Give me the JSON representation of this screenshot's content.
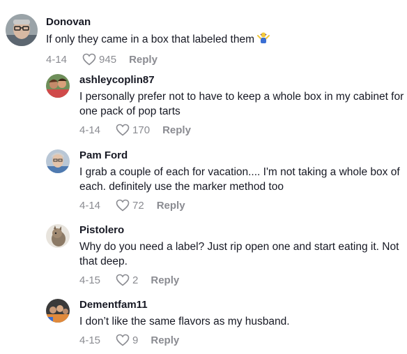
{
  "comments": [
    {
      "username": "Donovan",
      "text": "If only they came in a box that labeled them",
      "emoji_icon": "person-shrugging-emoji",
      "date": "4-14",
      "likes": "945",
      "reply_label": "Reply"
    },
    {
      "username": "ashleycoplin87",
      "text": "I personally prefer not to have to keep a whole box in my cabinet for one pack of pop tarts",
      "date": "4-14",
      "likes": "170",
      "reply_label": "Reply"
    },
    {
      "username": "Pam Ford",
      "text": "I grab a couple of each for vacation.... I'm not taking a whole box of each. definitely use the marker method too",
      "date": "4-14",
      "likes": "72",
      "reply_label": "Reply"
    },
    {
      "username": "Pistolero",
      "text": "Why do you need a label? Just rip open one and start eating it. Not that deep.",
      "date": "4-15",
      "likes": "2",
      "reply_label": "Reply"
    },
    {
      "username": "Dementfam11",
      "text": "I don’t like the same flavors as my husband.",
      "date": "4-15",
      "likes": "9",
      "reply_label": "Reply"
    }
  ],
  "colors": {
    "primary_text": "#161823",
    "secondary_text": "#8a8b91",
    "background": "#ffffff"
  }
}
